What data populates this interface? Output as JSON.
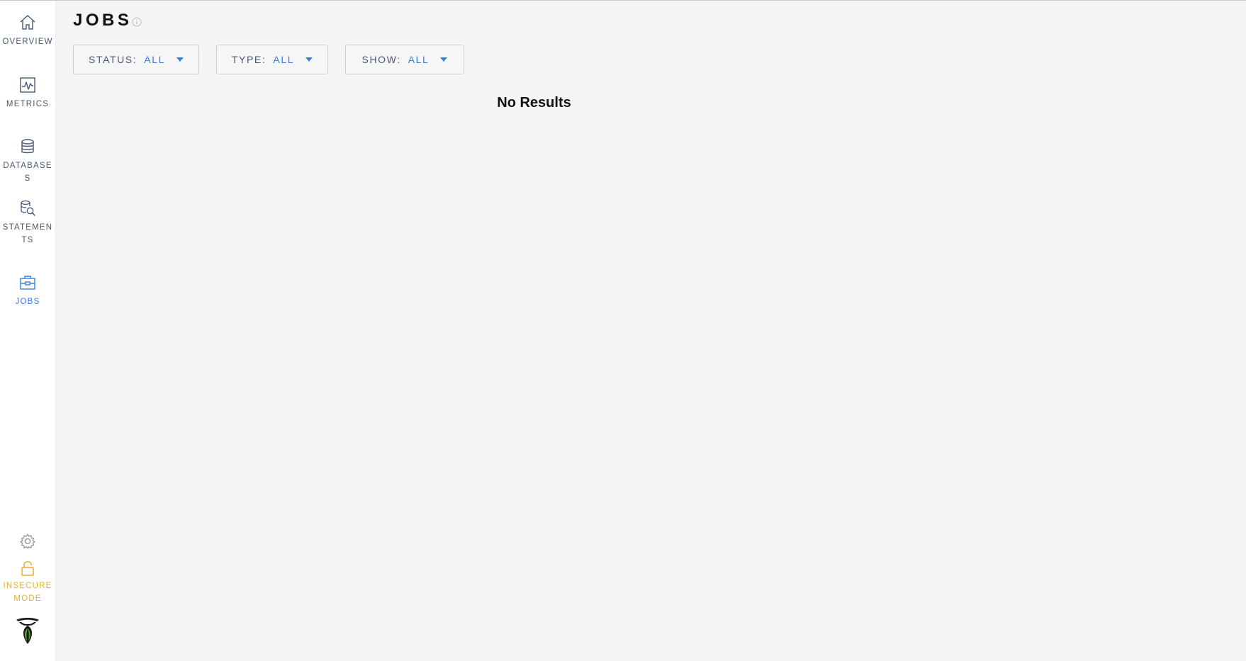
{
  "sidebar": {
    "items": [
      {
        "label": "OVERVIEW",
        "icon": "home-icon"
      },
      {
        "label": "METRICS",
        "icon": "metrics-chart-icon"
      },
      {
        "label": "DATABASES",
        "icon": "database-icon"
      },
      {
        "label": "STATEMENTS",
        "icon": "statements-search-icon"
      },
      {
        "label": "JOBS",
        "icon": "briefcase-icon",
        "active": true
      }
    ],
    "bottom": {
      "settings_icon": "gear-icon",
      "insecure_label": "INSECURE MODE",
      "insecure_icon": "unlock-icon",
      "logo_icon": "cockroach-logo-icon"
    }
  },
  "page": {
    "title": "JOBS",
    "title_info_icon": "info-icon"
  },
  "filters": [
    {
      "label": "STATUS:",
      "value": "ALL"
    },
    {
      "label": "TYPE:",
      "value": "ALL"
    },
    {
      "label": "SHOW:",
      "value": "ALL"
    }
  ],
  "results": {
    "empty_text": "No Results"
  },
  "colors": {
    "accent": "#3a7de1",
    "nav_text": "#475872",
    "warning": "#e6b325",
    "background": "#f5f5f5"
  }
}
